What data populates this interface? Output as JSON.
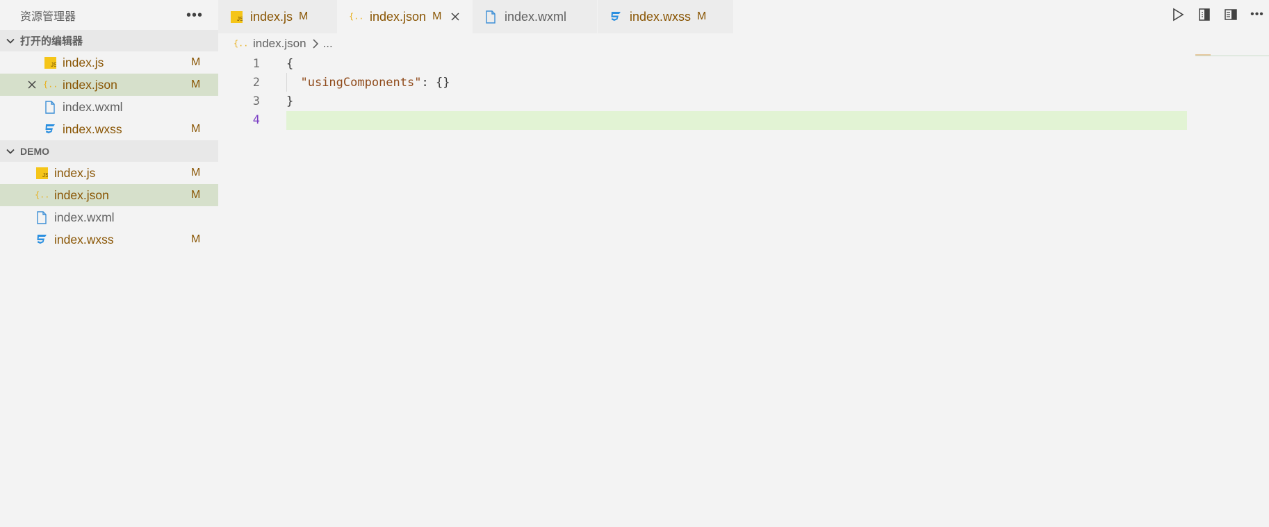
{
  "explorer": {
    "title": "资源管理器",
    "more_icon": "more-horizontal-icon",
    "open_editors": {
      "header": "打开的编辑器",
      "items": [
        {
          "name": "index.js",
          "icon": "js-file-icon",
          "status": "M",
          "selected": false
        },
        {
          "name": "index.json",
          "icon": "json-file-icon",
          "status": "M",
          "selected": true
        },
        {
          "name": "index.wxml",
          "icon": "file-icon",
          "status": "",
          "selected": false
        },
        {
          "name": "index.wxss",
          "icon": "css-file-icon",
          "status": "M",
          "selected": false
        }
      ]
    },
    "folder": {
      "header": "DEMO",
      "items": [
        {
          "name": "index.js",
          "icon": "js-file-icon",
          "status": "M"
        },
        {
          "name": "index.json",
          "icon": "json-file-icon",
          "status": "M"
        },
        {
          "name": "index.wxml",
          "icon": "file-icon",
          "status": ""
        },
        {
          "name": "index.wxss",
          "icon": "css-file-icon",
          "status": "M"
        }
      ]
    }
  },
  "tabs": [
    {
      "label": "index.js",
      "status": "M",
      "active": false
    },
    {
      "label": "index.json",
      "status": "M",
      "active": true
    },
    {
      "label": "index.wxml",
      "status": "",
      "active": false
    },
    {
      "label": "index.wxss",
      "status": "M",
      "active": false
    }
  ],
  "breadcrumb": {
    "file": "index.json",
    "more": "..."
  },
  "editor": {
    "lines": [
      {
        "number": "1",
        "text": "{"
      },
      {
        "number": "2",
        "key": "\"usingComponents\"",
        "rest": ": {}"
      },
      {
        "number": "3",
        "text": "}"
      },
      {
        "number": "4",
        "text": ""
      }
    ],
    "current_line": 4
  },
  "colors": {
    "modified": "#895503",
    "selected_row": "#d6e0cb",
    "current_line_highlight": "#e2f3d4",
    "js_icon": "#f5c518",
    "css_icon": "#2a8fe0",
    "json_icon": "#e8b01e",
    "file_icon": "#3d8fd6"
  }
}
